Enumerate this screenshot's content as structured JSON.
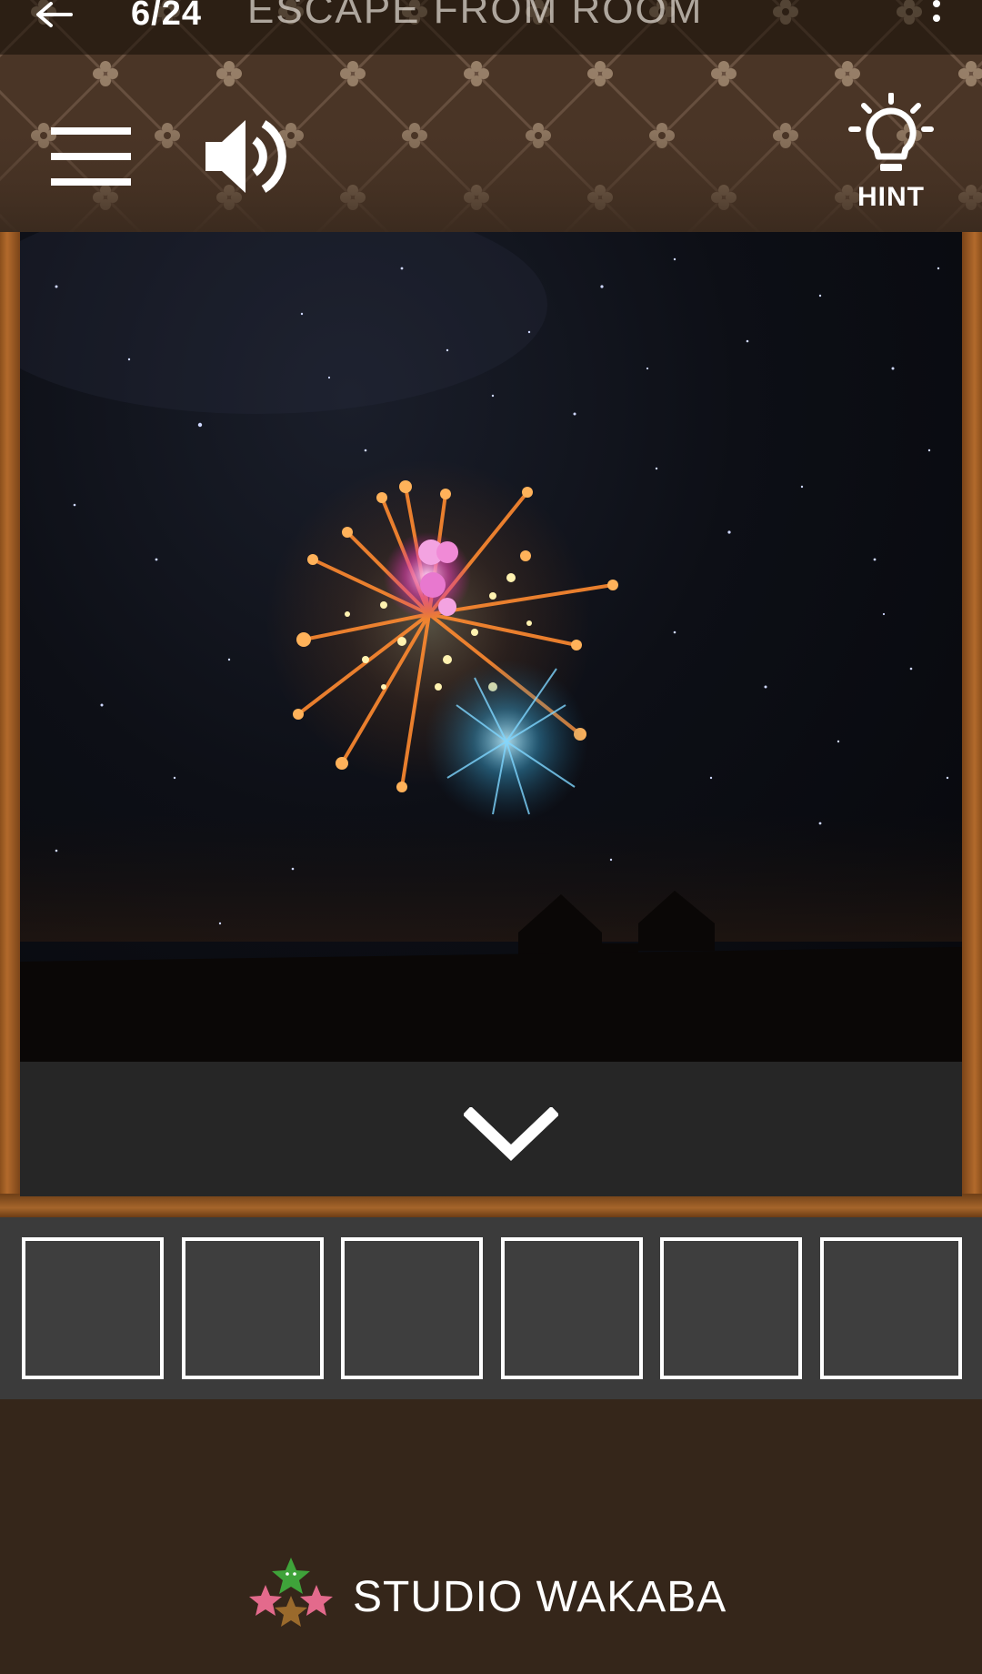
{
  "status_bar": {
    "level": "6/24",
    "title": "ESCAPE FROM ROOM"
  },
  "toolbar": {
    "menu_icon": "hamburger-menu-icon",
    "sound_icon": "speaker-volume-icon",
    "hint_icon": "lightbulb-icon",
    "hint_label": "HINT"
  },
  "scene": {
    "description_icons": [
      "fireworks",
      "night-sky",
      "house-silhouette"
    ],
    "nav_icon": "chevron-down-icon"
  },
  "inventory": {
    "slots": [
      "",
      "",
      "",
      "",
      "",
      ""
    ]
  },
  "footer": {
    "studio_name": "STUDIO WAKABA",
    "logo_icon": "three-stars-logo"
  },
  "colors": {
    "header_bg": "#4a3526",
    "frame_wood": "#7a4419",
    "nav_bar": "#262626",
    "inventory_bg": "#3b3b3b",
    "footer_bg": "#35261a"
  }
}
